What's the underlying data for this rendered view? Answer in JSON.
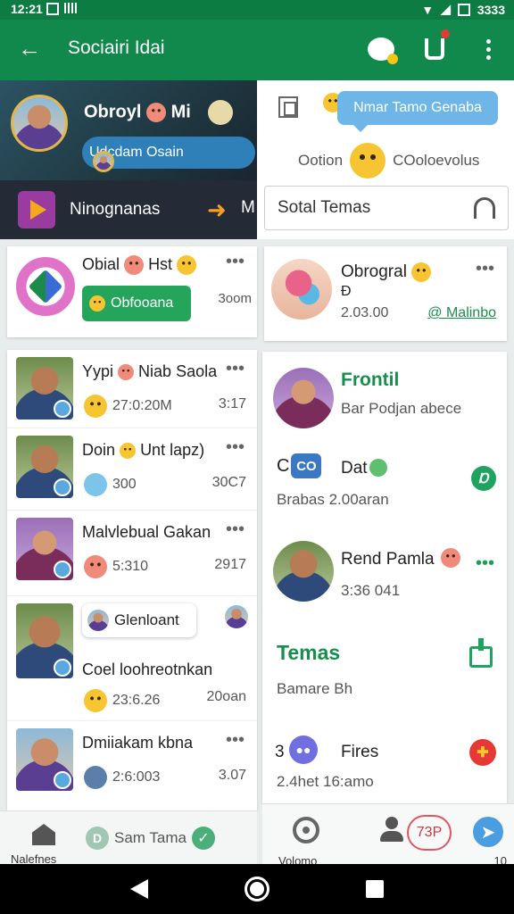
{
  "status_bar": {
    "time": "12:21",
    "battery": "3333"
  },
  "app_bar": {
    "title": "Sociairi Idai"
  },
  "profile": {
    "name": "Obroyl",
    "name_suffix": "Mi",
    "status": "Udcdam Osain"
  },
  "media_bar": {
    "label": "Ninognanas",
    "cut_label": "M"
  },
  "right_top": {
    "tooltip": "Nmar Tamo Genaba",
    "status_left": "Ootion",
    "status_right": "COoloevolus",
    "search_placeholder": "Sotal Temas"
  },
  "group_card": {
    "name": "Obial",
    "name_suffix": "Hst",
    "button": "Obfooana",
    "side_text": "3oom"
  },
  "group2_card": {
    "name": "Obrogral",
    "sub": "Ð",
    "time": "2.03.00",
    "link": "@ Malinbo"
  },
  "list": [
    {
      "name": "Yypi",
      "name_suffix": "Niab Saola",
      "sub": "27:0:20M",
      "time": "3:17"
    },
    {
      "name": "Doin",
      "name_suffix": "Unt lapz)",
      "sub": "300",
      "time": "30C7"
    },
    {
      "name": "Malvlebual Gakan",
      "sub": "5:310",
      "time": "2917"
    },
    {
      "bubble": "Glenloant",
      "name": "Coel loohreotnkan",
      "sub": "23:6.26",
      "time": "20oan"
    },
    {
      "name": "Dmiiakam kbna",
      "sub": "2:6:003",
      "time": "3.07"
    }
  ],
  "contacts": {
    "c1_name": "Frontil",
    "c1_sub": "Bar Podjan abece",
    "c2_title": "Dat",
    "c2_prefix": "C",
    "c2_box": "CO",
    "c2_sub": "Brabas 2.00aran",
    "c3_title": "Rend Pamla",
    "c3_sub": "3:36 041",
    "section_title": "Temas",
    "section_sub": "Bamare Bh",
    "c4_num": "3",
    "c4_title": "Fires",
    "c4_sub": "2.4het 16:amo"
  },
  "bottom_left": {
    "home_label": "Nalefnes",
    "search_label": "Sam Tama",
    "ring_label": "D"
  },
  "bottom_right": {
    "q_label": "Volomo",
    "badge": "73P",
    "num_label": "10"
  }
}
